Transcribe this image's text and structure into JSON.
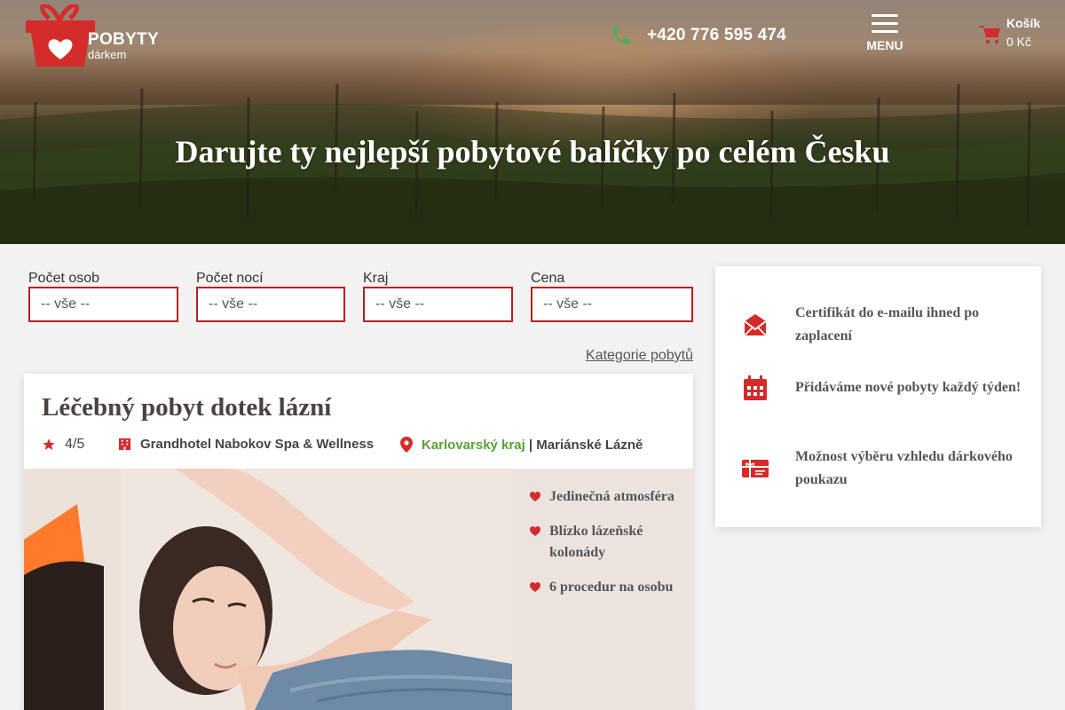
{
  "header": {
    "logo": {
      "line1": "POBYTY",
      "line2": "dárkem"
    },
    "phone": "+420 776 595 474",
    "menu_label": "MENU",
    "cart": {
      "label": "Košík",
      "price": "0 Kč"
    }
  },
  "hero": {
    "title": "Darujte ty nejlepší pobytové balíčky po celém Česku"
  },
  "filters": [
    {
      "label": "Počet osob",
      "value": "-- vše --"
    },
    {
      "label": "Počet nocí",
      "value": "-- vše --"
    },
    {
      "label": "Kraj",
      "value": "-- vše --"
    },
    {
      "label": "Cena",
      "value": "-- vše --"
    }
  ],
  "category_link": "Kategorie pobytů",
  "product": {
    "title": "Léčebný pobyt dotek lázní",
    "rating": "4/5",
    "hotel": "Grandhotel Nabokov Spa & Wellness",
    "region": "Karlovarský kraj",
    "separator": " | ",
    "city": "Mariánské Lázně",
    "features": [
      "Jedinečná atmosféra",
      "Blízko lázeňské kolonády",
      "6 procedur na osobu"
    ]
  },
  "benefits": [
    {
      "icon": "envelope-icon",
      "text": "Certifikát do e-mailu ihned po zaplacení"
    },
    {
      "icon": "calendar-icon",
      "text": "Přidáváme nové pobyty každý týden!"
    },
    {
      "icon": "gift-card-icon",
      "text": "Možnost výběru vzhledu dárkového poukazu"
    }
  ],
  "colors": {
    "accent": "#d42b2b",
    "border": "#b82020",
    "green": "#5aa03a",
    "phone_green": "#4caf50"
  }
}
